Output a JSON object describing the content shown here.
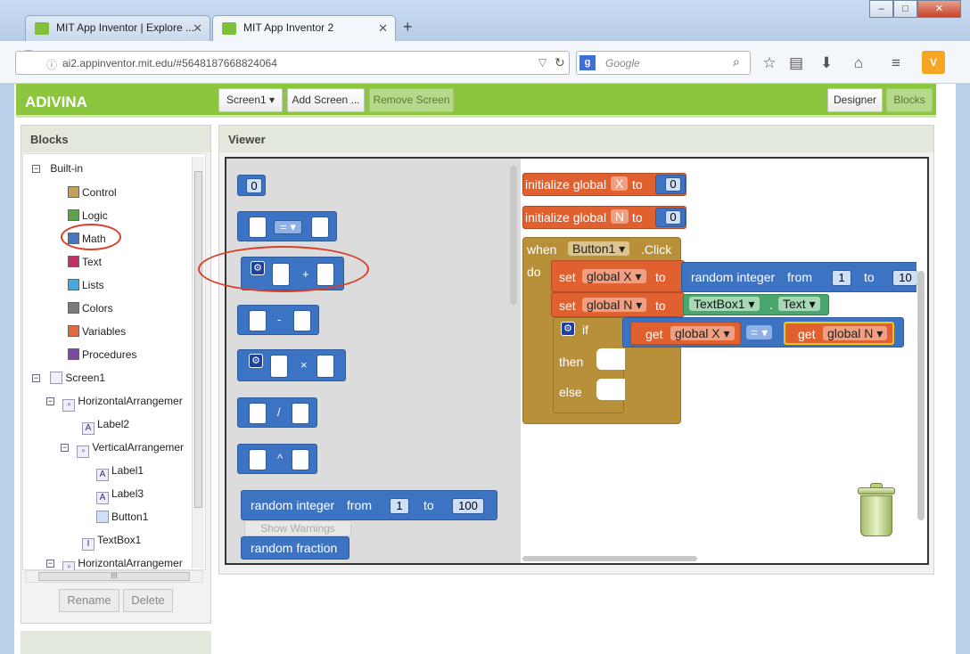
{
  "browser": {
    "tabs": [
      {
        "title": "MIT App Inventor | Explore ..."
      },
      {
        "title": "MIT App Inventor 2"
      }
    ],
    "new_tab": "+",
    "url": "ai2.appinventor.mit.edu/#5648187668824064",
    "search_placeholder": "Google",
    "window_controls": [
      "–",
      "□",
      "✕"
    ]
  },
  "app": {
    "name": "ADIVINA",
    "screen_select": "Screen1 ▾",
    "add_screen": "Add Screen ...",
    "remove_screen": "Remove Screen",
    "designer": "Designer",
    "blocks": "Blocks"
  },
  "blocks_panel": {
    "title": "Blocks",
    "builtin": "Built-in",
    "categories": [
      {
        "label": "Control",
        "color": "#c4a05a"
      },
      {
        "label": "Logic",
        "color": "#5ca34a"
      },
      {
        "label": "Math",
        "color": "#4877c4"
      },
      {
        "label": "Text",
        "color": "#c4306a"
      },
      {
        "label": "Lists",
        "color": "#49a6d8"
      },
      {
        "label": "Colors",
        "color": "#7a7a7a"
      },
      {
        "label": "Variables",
        "color": "#e06a3a"
      },
      {
        "label": "Procedures",
        "color": "#7b4aa0"
      }
    ],
    "components": [
      {
        "label": "Screen1",
        "level": 0
      },
      {
        "label": "HorizontalArrangemer",
        "level": 1
      },
      {
        "label": "Label2",
        "level": 2
      },
      {
        "label": "VerticalArrangemer",
        "level": 2
      },
      {
        "label": "Label1",
        "level": 3
      },
      {
        "label": "Label3",
        "level": 3
      },
      {
        "label": "Button1",
        "level": 3
      },
      {
        "label": "TextBox1",
        "level": 2
      },
      {
        "label": "HorizontalArrangemer",
        "level": 1
      }
    ],
    "scroll_mid": "III",
    "rename": "Rename",
    "delete": "Delete"
  },
  "viewer": {
    "title": "Viewer",
    "flyout": {
      "number": "0",
      "eq_op": "= ▾",
      "plus": "+",
      "minus": "-",
      "times": "×",
      "divide": "/",
      "power": "^",
      "random_integer": "random integer",
      "from": "from",
      "to": "to",
      "from_val": "1",
      "to_val": "100",
      "random_fraction": "random fraction",
      "show_warnings": "Show Warnings"
    },
    "workspace": {
      "init_x": "initialize global",
      "var_x": "X",
      "to": "to",
      "init_x_val": "0",
      "var_n": "N",
      "init_n_val": "0",
      "when": "when",
      "button": "Button1 ▾",
      "click": ".Click",
      "do": "do",
      "set": "set",
      "global_x": "global X ▾",
      "global_n": "global N ▾",
      "random_integer": "random integer",
      "from": "from",
      "ri_from": "1",
      "ri_to": "10",
      "textbox": "TextBox1 ▾",
      "dot": ".",
      "text_prop": "Text ▾",
      "if": "if",
      "get": "get",
      "get_x": "global X ▾",
      "eq": "= ▾",
      "get_n": "global N ▾",
      "then": "then",
      "else": "else"
    }
  }
}
